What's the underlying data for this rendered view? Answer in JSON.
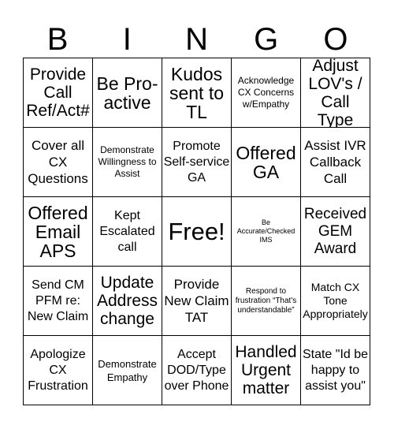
{
  "header": {
    "letters": [
      "B",
      "I",
      "N",
      "G",
      "O"
    ]
  },
  "board": {
    "rows": [
      [
        {
          "text": "Provide Call Ref/Act#"
        },
        {
          "text": "Be Pro-active"
        },
        {
          "text": "Kudos sent to TL"
        },
        {
          "text": "Acknowledge CX Concerns w/Empathy"
        },
        {
          "text": "Adjust LOV's / Call Type"
        }
      ],
      [
        {
          "text": "Cover all CX Questions"
        },
        {
          "text": "Demonstrate Willingness to Assist"
        },
        {
          "text": "Promote Self-service GA"
        },
        {
          "text": "Offered GA"
        },
        {
          "text": "Assist IVR Callback Call"
        }
      ],
      [
        {
          "text": "Offered Email APS"
        },
        {
          "text": "Kept Escalated call"
        },
        {
          "text": "Free!"
        },
        {
          "text": "Be Accurate/Checked IMS"
        },
        {
          "text": "Received GEM Award"
        }
      ],
      [
        {
          "text": "Send CM PFM re: New Claim"
        },
        {
          "text": "Update Address change"
        },
        {
          "text": "Provide New Claim TAT"
        },
        {
          "text": "Respond to frustration “That's understandable”"
        },
        {
          "text": "Match CX Tone Appropriately"
        }
      ],
      [
        {
          "text": "Apologize CX Frustration"
        },
        {
          "text": "Demonstrate Empathy"
        },
        {
          "text": "Accept DOD/Type over Phone"
        },
        {
          "text": "Handled Urgent matter"
        },
        {
          "text": "State \"Id be happy to assist you\""
        }
      ]
    ],
    "free_space_position": [
      2,
      2
    ]
  }
}
